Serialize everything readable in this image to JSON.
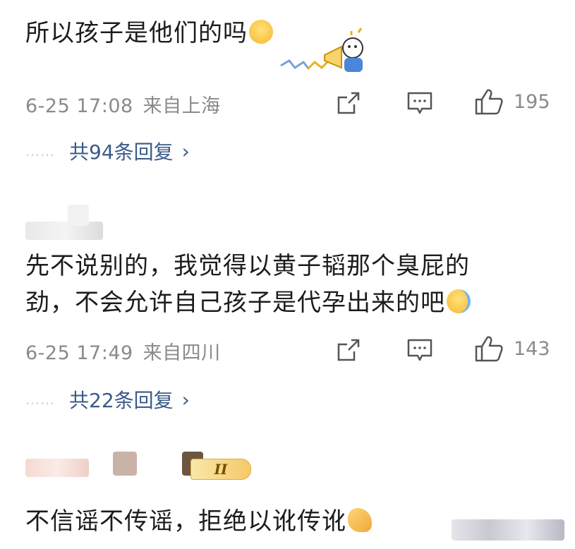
{
  "comments": [
    {
      "text": "所以孩子是他们的吗",
      "emoji": "pleading-face-emoji",
      "time": "6-25 17:08",
      "location": "来自上海",
      "likes": "195",
      "replies": "共94条回复",
      "dots": "……"
    },
    {
      "text_line1": "先不说别的，我觉得以黄子韬那个臭屁的",
      "text_line2": "劲，不会允许自己孩子是代孕出来的吧",
      "emoji": "laughing-crying-emoji",
      "time": "6-25 17:49",
      "location": "来自四川",
      "likes": "143",
      "replies": "共22条回复",
      "dots": "……"
    },
    {
      "text": "不信谣不传谣，拒绝以讹传讹",
      "emoji": "flexed-biceps-emoji",
      "badge": "II"
    }
  ],
  "icons": [
    "share-icon",
    "comment-icon",
    "like-icon",
    "chevron-right-icon",
    "megaphone-sticker"
  ],
  "colors": {
    "text": "#1c1c1c",
    "meta": "#8a8a8a",
    "link": "#3b5a8a"
  }
}
